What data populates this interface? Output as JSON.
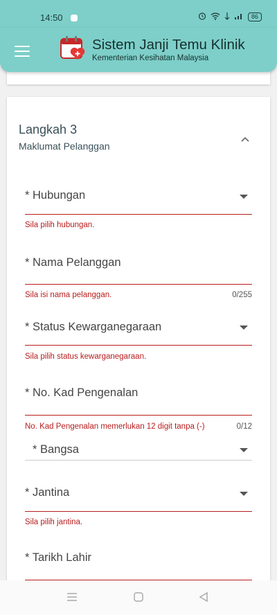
{
  "status_bar": {
    "time": "14:50",
    "battery": "86"
  },
  "app": {
    "title": "Sistem Janji Temu Klinik",
    "subtitle": "Kementerian Kesihatan Malaysia"
  },
  "step": {
    "title": "Langkah 3",
    "subtitle": "Maklumat Pelanggan"
  },
  "fields": {
    "hubungan": {
      "label": "* Hubungan",
      "error": "Sila pilih hubungan."
    },
    "nama": {
      "label": "* Nama Pelanggan",
      "error": "Sila isi nama pelanggan.",
      "counter": "0/255"
    },
    "kewarganegaraan": {
      "label": "* Status Kewarganegaraan",
      "error": "Sila pilih status kewarganegaraan."
    },
    "kad": {
      "label": "* No. Kad Pengenalan",
      "error": "No. Kad Pengenalan memerlukan 12 digit tanpa (-)",
      "counter": "0/12"
    },
    "bangsa": {
      "label": "* Bangsa"
    },
    "jantina": {
      "label": "* Jantina",
      "error": "Sila pilih jantina."
    },
    "tarikh": {
      "label": "* Tarikh Lahir"
    }
  },
  "colors": {
    "accent": "#7ecfc9",
    "error": "#b71c1c"
  }
}
